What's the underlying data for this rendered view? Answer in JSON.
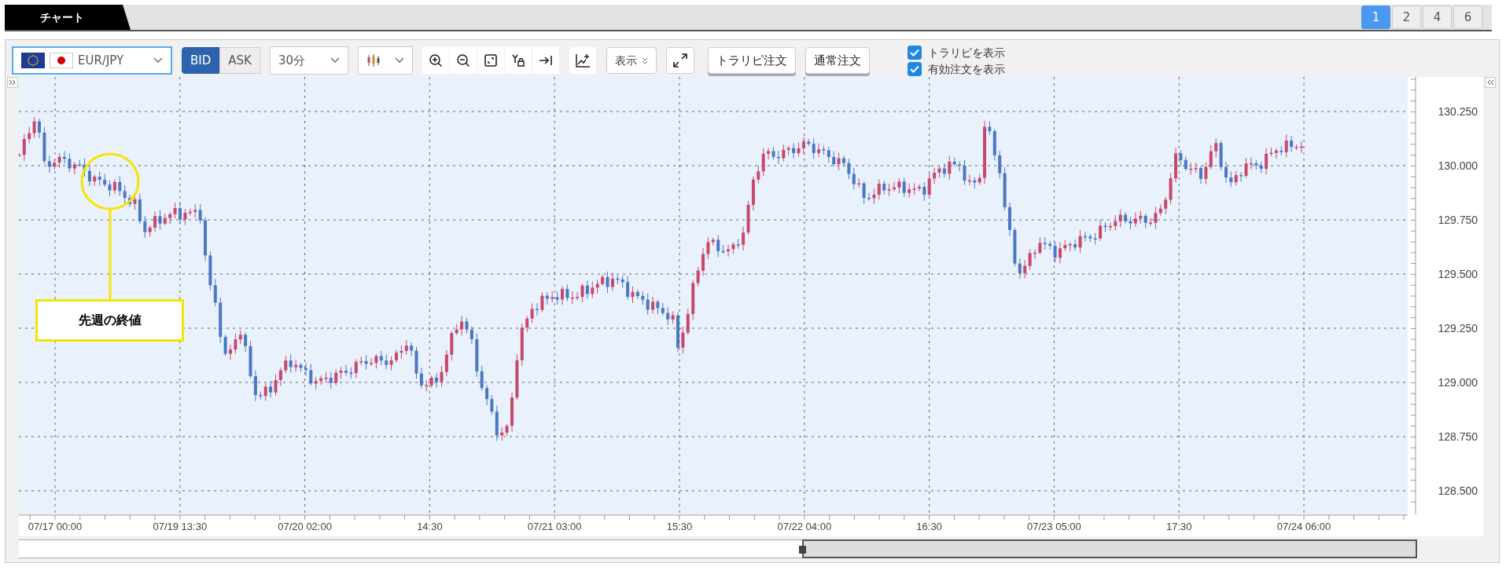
{
  "tab": {
    "label": "チャート",
    "selected": true
  },
  "layouts": [
    {
      "label": "1",
      "selected": true
    },
    {
      "label": "2",
      "selected": false
    },
    {
      "label": "4",
      "selected": false
    },
    {
      "label": "6",
      "selected": false
    }
  ],
  "toolbar": {
    "symbol": "EUR/JPY",
    "price_sides": [
      {
        "label": "BID",
        "selected": true
      },
      {
        "label": "ASK",
        "selected": false
      }
    ],
    "interval": "30分",
    "display_menu": "表示",
    "order_buttons": [
      "トラリピ注文",
      "通常注文"
    ],
    "options": [
      {
        "label": "トラリピを表示",
        "checked": true
      },
      {
        "label": "有効注文を表示",
        "checked": true
      }
    ]
  },
  "chart": {
    "y_axis": [
      "130.250",
      "130.000",
      "129.750",
      "129.500",
      "129.250",
      "129.000",
      "128.750",
      "128.500"
    ],
    "x_axis": [
      "07/17 00:00",
      "07/19 13:30",
      "07/20 02:00",
      "14:30",
      "07/21 03:00",
      "15:30",
      "07/22 04:00",
      "16:30",
      "07/23 05:00",
      "17:30",
      "07/24 06:00"
    ],
    "annotation": "先週の終値"
  }
}
